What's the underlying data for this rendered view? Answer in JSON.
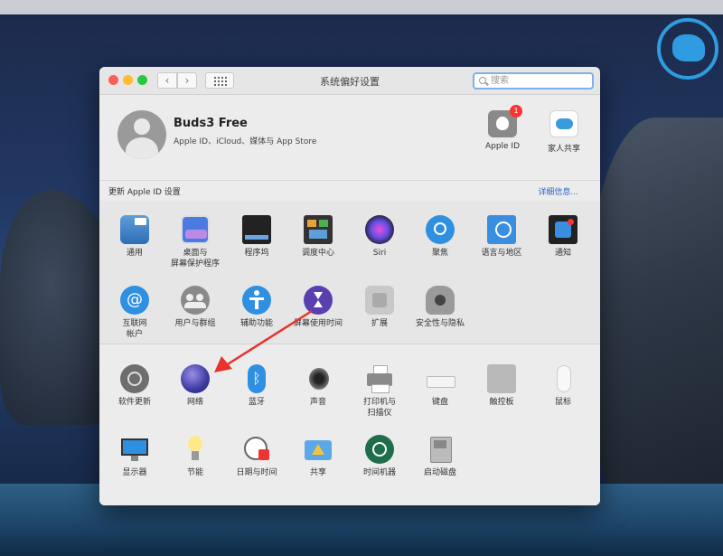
{
  "window": {
    "title": "系统偏好设置",
    "search_placeholder": "搜索"
  },
  "account": {
    "name": "Buds3 Free",
    "subtitle": "Apple ID、iCloud、媒体与 App Store",
    "apple_id_label": "Apple ID",
    "apple_id_badge": "1",
    "family_label": "家人共享"
  },
  "update_bar": {
    "text": "更新 Apple ID 设置",
    "link": "详细信息..."
  },
  "section1": [
    {
      "label": "通用",
      "icon": "general-icon"
    },
    {
      "label": "桌面与\n屏幕保护程序",
      "icon": "desktop-icon"
    },
    {
      "label": "程序坞",
      "icon": "dock-icon"
    },
    {
      "label": "调度中心",
      "icon": "mission-control-icon"
    },
    {
      "label": "Siri",
      "icon": "siri-icon"
    },
    {
      "label": "聚焦",
      "icon": "spotlight-icon"
    },
    {
      "label": "语言与地区",
      "icon": "language-icon"
    },
    {
      "label": "通知",
      "icon": "notifications-icon"
    },
    {
      "label": "互联网\n帐户",
      "icon": "internet-accounts-icon"
    },
    {
      "label": "用户与群组",
      "icon": "users-icon"
    },
    {
      "label": "辅助功能",
      "icon": "accessibility-icon"
    },
    {
      "label": "屏幕使用时间",
      "icon": "screen-time-icon"
    },
    {
      "label": "扩展",
      "icon": "extensions-icon"
    },
    {
      "label": "安全性与隐私",
      "icon": "security-icon"
    }
  ],
  "section2": [
    {
      "label": "软件更新",
      "icon": "software-update-icon"
    },
    {
      "label": "网络",
      "icon": "network-icon"
    },
    {
      "label": "蓝牙",
      "icon": "bluetooth-icon"
    },
    {
      "label": "声音",
      "icon": "sound-icon"
    },
    {
      "label": "打印机与\n扫描仪",
      "icon": "printer-icon"
    },
    {
      "label": "键盘",
      "icon": "keyboard-icon"
    },
    {
      "label": "触控板",
      "icon": "trackpad-icon"
    },
    {
      "label": "鼠标",
      "icon": "mouse-icon"
    },
    {
      "label": "显示器",
      "icon": "display-icon"
    },
    {
      "label": "节能",
      "icon": "energy-icon"
    },
    {
      "label": "日期与时间",
      "icon": "date-time-icon"
    },
    {
      "label": "共享",
      "icon": "sharing-icon"
    },
    {
      "label": "时间机器",
      "icon": "time-machine-icon"
    },
    {
      "label": "启动磁盘",
      "icon": "startup-disk-icon"
    }
  ],
  "colors": {
    "accent": "#2a63c8",
    "arrow": "#e8322c"
  }
}
